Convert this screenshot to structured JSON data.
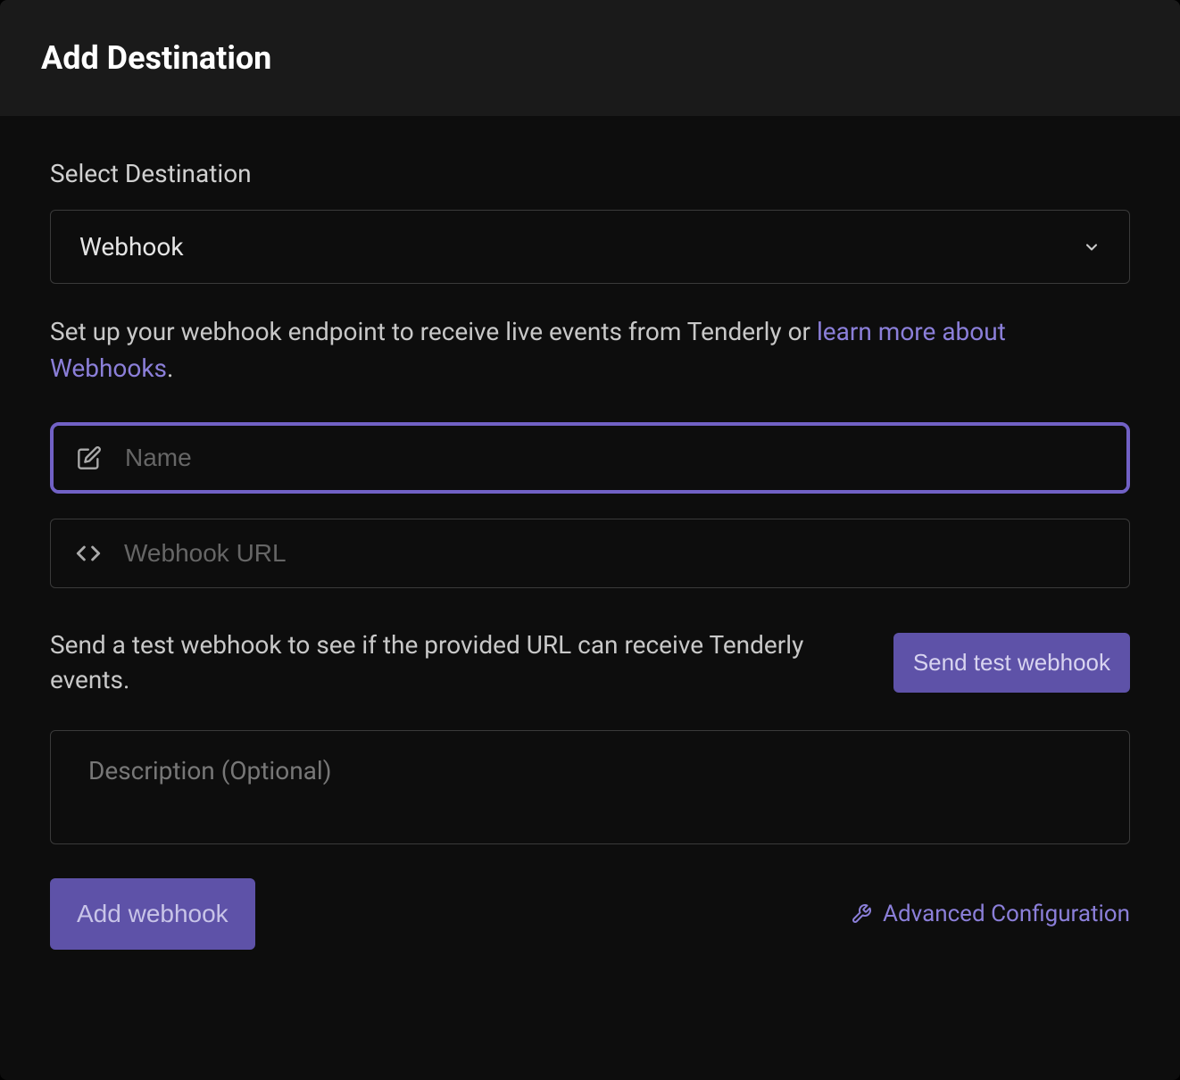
{
  "header": {
    "title": "Add Destination"
  },
  "form": {
    "select_label": "Select Destination",
    "select_value": "Webhook",
    "help_text_prefix": "Set up your webhook endpoint to receive live events from Tenderly or ",
    "help_link_text": "learn more about Webhooks",
    "help_text_suffix": ".",
    "name_placeholder": "Name",
    "name_value": "",
    "url_placeholder": "Webhook URL",
    "url_value": "",
    "test_text": "Send a test webhook to see if the provided URL can receive Tenderly events.",
    "test_button": "Send test webhook",
    "description_placeholder": "Description (Optional)",
    "description_value": "",
    "submit_button": "Add webhook",
    "advanced_link": "Advanced Configuration"
  }
}
